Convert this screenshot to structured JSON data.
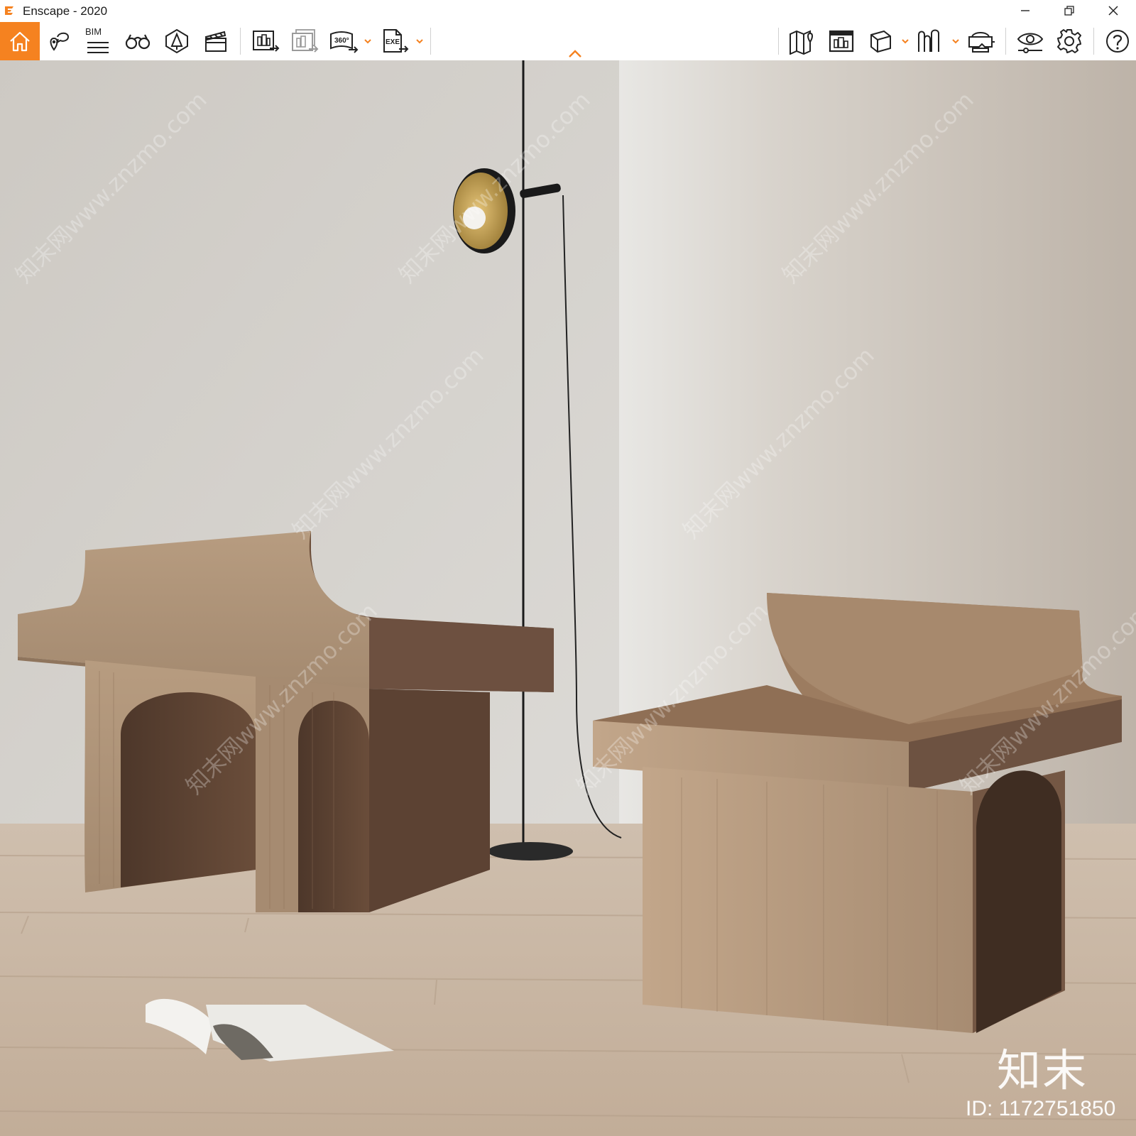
{
  "window": {
    "title": "Enscape - 2020",
    "controls": [
      "minimize",
      "restore",
      "close"
    ]
  },
  "toolbar": {
    "accent_color": "#f58220",
    "left_tools": [
      {
        "icon": "home-icon",
        "active": true
      },
      {
        "icon": "location-views-icon"
      },
      {
        "icon": "bim-info-icon",
        "label": "BIM"
      },
      {
        "icon": "binoculars-icon"
      },
      {
        "icon": "asset-library-icon"
      },
      {
        "icon": "clapperboard-icon"
      },
      {
        "icon": "screenshot-export-icon"
      },
      {
        "icon": "batch-render-icon"
      },
      {
        "icon": "panorama-360-icon",
        "label": "360°",
        "dropdown": true
      },
      {
        "icon": "exe-export-icon",
        "label": "EXE",
        "dropdown": true
      }
    ],
    "right_tools": [
      {
        "icon": "map-icon"
      },
      {
        "icon": "building-view-icon"
      },
      {
        "icon": "cube-icon",
        "dropdown": true
      },
      {
        "icon": "asset-editor-icon",
        "dropdown": true
      },
      {
        "icon": "vr-headset-icon"
      },
      {
        "icon": "visual-settings-icon"
      },
      {
        "icon": "gear-icon"
      },
      {
        "icon": "help-icon"
      }
    ]
  },
  "viewport": {
    "description_colors": {
      "wall": "#d6d3ce",
      "floor": "#c9b8a6",
      "wood_light": "#b89b7e",
      "wood_dark": "#5a4030"
    },
    "watermark_text": "知末网www.znzmo.com",
    "brand_mark": "知末",
    "image_id": "ID: 1172751850"
  }
}
